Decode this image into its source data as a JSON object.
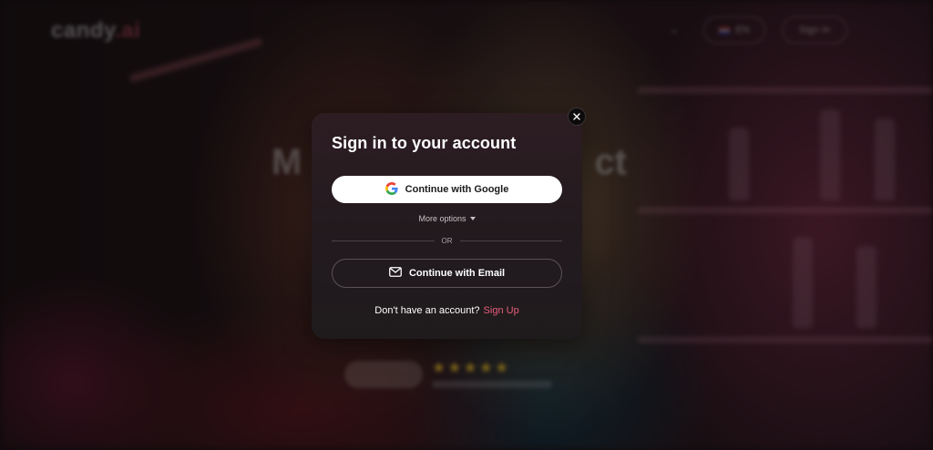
{
  "background": {
    "logo": {
      "text": "candy",
      "suffix": ".ai"
    },
    "language": "EN",
    "sign_in_label": "Sign In",
    "headline_left": "M",
    "headline_right": "ct",
    "stars": "★★★★★"
  },
  "modal": {
    "title": "Sign in to your account",
    "google_button_label": "Continue with Google",
    "more_options_label": "More options",
    "divider_label": "OR",
    "email_button_label": "Continue with Email",
    "signup_prompt": "Don't have an account?",
    "signup_link": "Sign Up"
  },
  "colors": {
    "accent": "#e85d7a",
    "modal_bg": "#241b1f",
    "button_white": "#ffffff"
  },
  "icons": {
    "close": "close-icon",
    "google": "google-icon",
    "email": "envelope-icon",
    "more_options": "caret-down-icon"
  }
}
